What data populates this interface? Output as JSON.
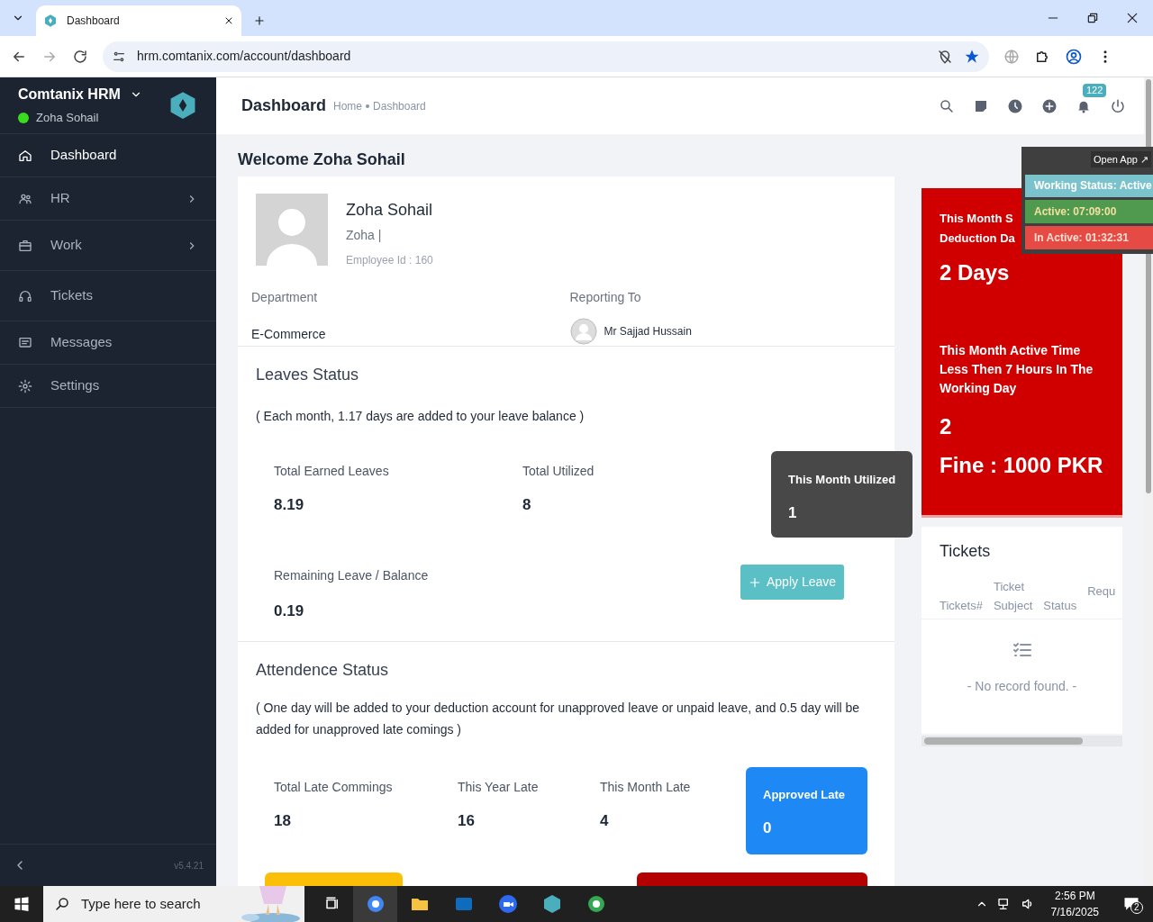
{
  "browser": {
    "tabs": [
      {
        "title": "Dashboard",
        "selected": true
      }
    ],
    "url": "hrm.comtanix.com/account/dashboard"
  },
  "sidebar": {
    "brand": "Comtanix HRM",
    "user": "Zoha Sohail",
    "online": true,
    "items": [
      {
        "label": "Dashboard",
        "selected": true,
        "has_children": false
      },
      {
        "label": "HR",
        "selected": false,
        "has_children": true
      },
      {
        "label": "Work",
        "selected": false,
        "has_children": true
      },
      {
        "label": "Tickets",
        "selected": false,
        "has_children": false
      },
      {
        "label": "Messages",
        "selected": false,
        "has_children": false
      },
      {
        "label": "Settings",
        "selected": false,
        "has_children": false
      }
    ],
    "version": "v5.4.21"
  },
  "header": {
    "title": "Dashboard",
    "breadcrumb": [
      "Home",
      "Dashboard"
    ],
    "notification_count": "122"
  },
  "welcome": "Welcome Zoha Sohail",
  "profile": {
    "name": "Zoha Sohail",
    "nickname": "Zoha |",
    "employee_id": "Employee Id : 160",
    "department_label": "Department",
    "department": "E-Commerce",
    "reporting_label": "Reporting To",
    "reporting_to": "Mr Sajjad Hussain"
  },
  "leaves": {
    "title": "Leaves Status",
    "note": "( Each month, 1.17 days are added to your leave balance )",
    "stats": [
      {
        "label": "Total Earned Leaves",
        "value": "8.19"
      },
      {
        "label": "Total Utilized",
        "value": "8"
      }
    ],
    "this_month": {
      "label": "This Month Utilized",
      "value": "1"
    },
    "remaining": {
      "label": "Remaining Leave / Balance",
      "value": "0.19"
    },
    "apply_button": "Apply Leave"
  },
  "attendance": {
    "title": "Attendence Status",
    "note": "( One day will be added to your deduction account for unapproved leave or unpaid leave, and 0.5 day will be added for unapproved late comings )",
    "stats": [
      {
        "label": "Total Late Commings",
        "value": "18"
      },
      {
        "label": "This Year Late",
        "value": "16"
      },
      {
        "label": "This Month Late",
        "value": "4"
      }
    ],
    "approved": {
      "label": "Approved Late",
      "value": "0"
    }
  },
  "deduction": {
    "lines": [
      "This Month S",
      "Deduction Da"
    ],
    "days": "2 Days",
    "note": "This Month Active Time Less Then 7 Hours In The Working Day",
    "count": "2",
    "fine": "Fine : 1000 PKR"
  },
  "tracker": {
    "open_app": "Open App ↗",
    "working_status": "Working Status: Active",
    "active": "Active: 07:09:00",
    "inactive": "In Active: 01:32:31"
  },
  "tickets": {
    "title": "Tickets",
    "columns": [
      [
        "Tickets#"
      ],
      [
        "Ticket",
        "Subject"
      ],
      [
        "Status"
      ],
      [
        "Requ"
      ]
    ],
    "empty_text": "- No record found. -"
  },
  "taskbar": {
    "search_placeholder": "Type here to search",
    "time": "2:56 PM",
    "date": "7/16/2025",
    "notification_count": "2"
  }
}
